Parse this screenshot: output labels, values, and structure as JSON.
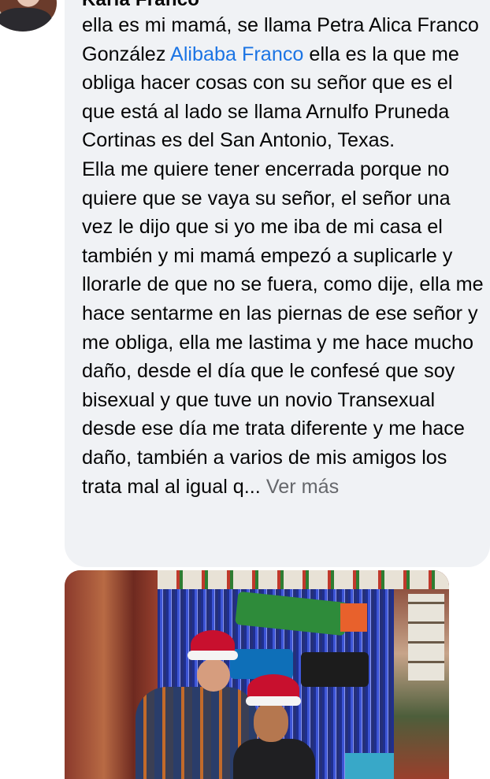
{
  "comment": {
    "author": "Karla Franco",
    "text_before_mention": "ella es mi mamá, se llama Petra Alica Franco González ",
    "mention": "Alibaba Franco",
    "text_after_mention": " ella es la que me obliga hacer cosas con su señor que es el que está al lado se llama Arnulfo Pruneda Cortinas es del San Antonio, Texas.",
    "paragraph2": "Ella me quiere tener encerrada porque no quiere que se vaya su señor, el señor una vez le dijo que si yo me iba de mi casa el también y mi mamá empezó a suplicarle y llorarle de que no se fuera, como dije, ella me hace sentarme en las piernas de ese señor y me obliga, ella me lastima y me hace mucho daño, desde el día que le confesé que soy bisexual y que tuve un novio Transexual desde ese día me trata diferente y me hace daño, también a varios de mis amigos los trata mal al igual q...",
    "see_more": "Ver más"
  },
  "colors": {
    "bubble": "#f0f2f5",
    "text": "#050505",
    "mention": "#1b74e4",
    "see_more": "#65676b"
  }
}
